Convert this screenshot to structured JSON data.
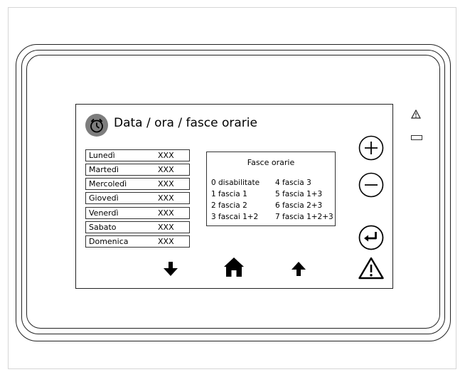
{
  "header": {
    "title": "Data / ora / fasce orarie",
    "icon": "alarm-clock-icon"
  },
  "days": [
    {
      "name": "Lunedì",
      "value": "XXX"
    },
    {
      "name": "Martedì",
      "value": "XXX"
    },
    {
      "name": "Mercoledì",
      "value": "XXX"
    },
    {
      "name": "Giovedì",
      "value": "XXX"
    },
    {
      "name": "Venerdì",
      "value": "XXX"
    },
    {
      "name": "Sabato",
      "value": "XXX"
    },
    {
      "name": "Domenica",
      "value": "XXX"
    }
  ],
  "bands": {
    "title": "Fasce orarie",
    "items": [
      "0 disabilitate",
      "1 fascia 1",
      "2 fascia 2",
      "3 fascai 1+2",
      "4 fascia 3",
      "5 fascia 1+3",
      "6 fascia 2+3",
      "7 fascia 1+2+3"
    ]
  },
  "icons": {
    "plus": "plus-circle-icon",
    "minus": "minus-circle-icon",
    "enter": "enter-return-icon",
    "warning": "warning-triangle-icon",
    "down": "arrow-down-icon",
    "home": "home-icon",
    "up": "arrow-up-icon",
    "device_alarm": "small-warning-icon",
    "led": "led-indicator"
  },
  "colors": {
    "clock_badge": "#7d7d7d",
    "outline": "#222222"
  }
}
